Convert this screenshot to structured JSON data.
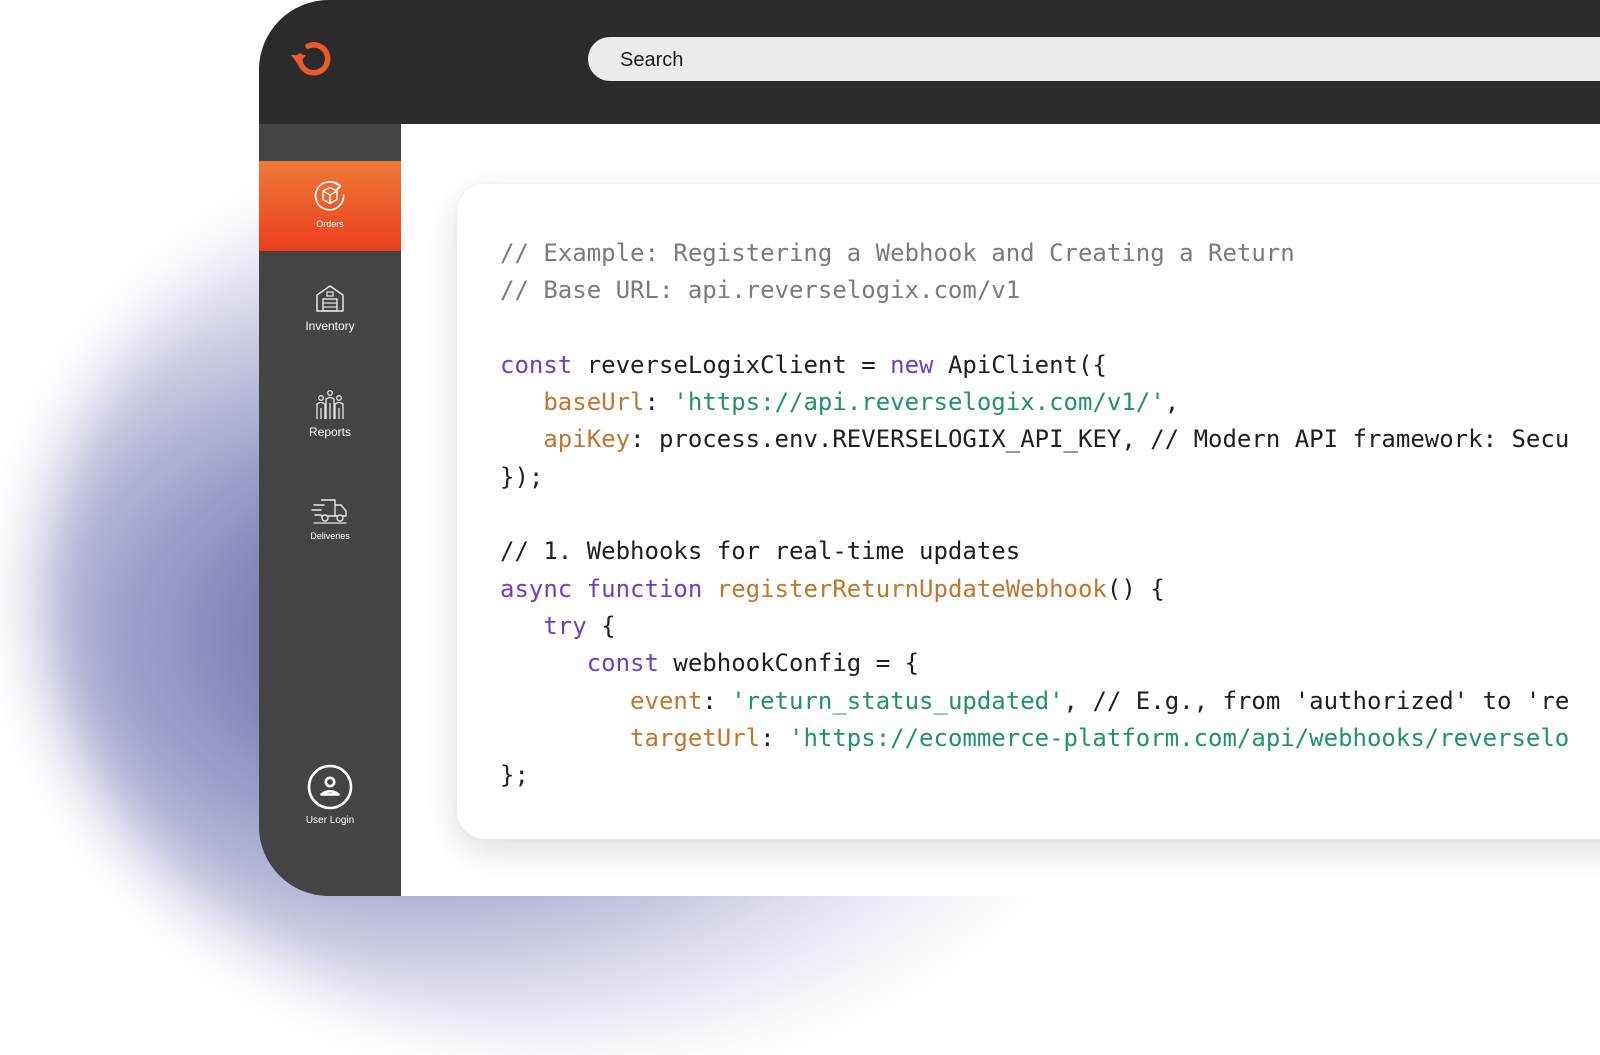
{
  "search": {
    "placeholder": "Search"
  },
  "sidebar": {
    "items": [
      {
        "label": "Orders",
        "icon": "box-return-icon",
        "active": true
      },
      {
        "label": "Inventory",
        "icon": "warehouse-icon",
        "active": false
      },
      {
        "label": "Reports",
        "icon": "people-chart-icon",
        "active": false
      },
      {
        "label": "Deliveries",
        "icon": "delivery-truck-icon",
        "active": false
      }
    ],
    "user": {
      "label": "User Login",
      "icon": "user-icon"
    }
  },
  "code": {
    "l1": "// Example: Registering a Webhook and Creating a Return",
    "l2": "// Base URL: api.reverselogix.com/v1",
    "l4": {
      "kw": "const",
      "a": " reverseLogixClient = ",
      "kw2": "new",
      "b": " ApiClient({"
    },
    "l5": {
      "indent": "   ",
      "prop": "baseUrl",
      "a": ": ",
      "str": "'https://api.reverselogix.com/v1/'",
      "b": ","
    },
    "l6": {
      "indent": "   ",
      "prop": "apiKey",
      "a": ": process.env.REVERSELOGIX_API_KEY, // Modern API framework: Secu"
    },
    "l7": "});",
    "l9": "// 1. Webhooks for real-time updates",
    "l10": {
      "kw": "async",
      "a": " ",
      "kw2": "function",
      "b": " ",
      "fn": "registerReturnUpdateWebhook",
      "c": "() {"
    },
    "l11": {
      "indent": "   ",
      "kw": "try",
      "a": " {"
    },
    "l12": {
      "indent": "      ",
      "kw": "const",
      "a": " webhookConfig = {"
    },
    "l13": {
      "indent": "         ",
      "prop": "event",
      "a": ": ",
      "str": "'return_status_updated'",
      "b": ", // E.g., from 'authorized' to 're"
    },
    "l14": {
      "indent": "         ",
      "prop": "targetUrl",
      "a": ": ",
      "str": "'https://ecommerce-platform.com/api/webhooks/reverselo"
    },
    "l15": "};"
  },
  "colors": {
    "frame": "#2b2b2b",
    "sidebar": "#444444",
    "accent_top": "#ef7a37",
    "accent_bottom": "#ea3e1f",
    "keyword": "#6e3ec7",
    "property": "#c2752f",
    "string": "#22926a",
    "comment": "#7b7b7b"
  }
}
